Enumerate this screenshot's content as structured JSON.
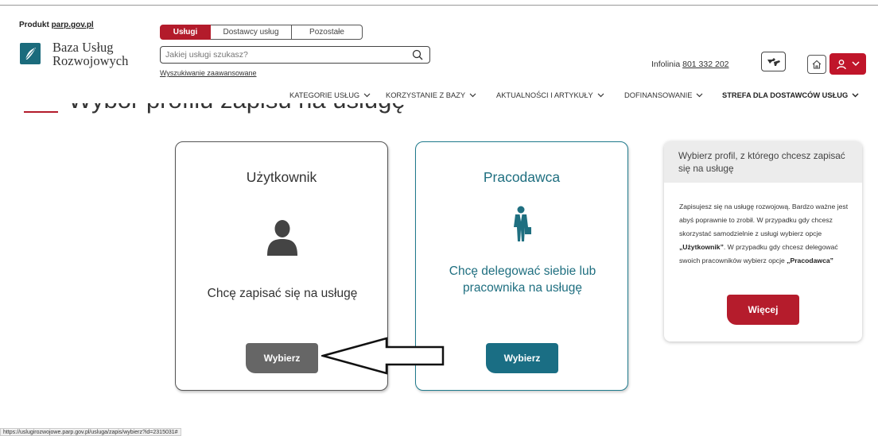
{
  "header": {
    "produkt_prefix": "Produkt ",
    "produkt_link": "parp.gov.pl",
    "logo_line1": "Baza Usług",
    "logo_line2": "Rozwojowych",
    "tabs": [
      {
        "label": "Usługi",
        "active": true
      },
      {
        "label": "Dostawcy usług",
        "active": false
      },
      {
        "label": "Pozostałe",
        "active": false
      }
    ],
    "search_placeholder": "Jakiej usługi szukasz?",
    "advanced_search": "Wyszukiwanie zaawansowane",
    "infolinia_label": "Infolinia ",
    "infolinia_number": "801 332 202",
    "accent_color": "#c0152a"
  },
  "nav": [
    {
      "label": "KATEGORIE USŁUG"
    },
    {
      "label": "KORZYSTANIE Z BAZY"
    },
    {
      "label": "AKTUALNOŚCI I ARTYKUŁY"
    },
    {
      "label": "DOFINANSOWANIE"
    },
    {
      "label": "STREFA DLA DOSTAWCÓW USŁUG"
    }
  ],
  "page": {
    "title": "Wybór profilu zapisu na usługę"
  },
  "cards": {
    "user": {
      "title": "Użytkownik",
      "description": "Chcę zapisać się na usługę",
      "button": "Wybierz"
    },
    "employer": {
      "title": "Pracodawca",
      "description": "Chcę delegować siebie lub pracownika na usługę",
      "button": "Wybierz"
    }
  },
  "info": {
    "heading": "Wybierz profil, z którego chcesz zapisać się na usługę",
    "body_1": "Zapisujesz się na usługę rozwojową. Bardzo ważne jest abyś poprawnie to zrobił. W przypadku gdy chcesz skorzystać samodzielnie z usługi wybierz opcje ",
    "body_user": "„Użytkownik”",
    "body_2": ". W przypadku gdy chcesz delegować swoich pracowników wybierz opcje ",
    "body_employer": "„Pracodawca”",
    "button": "Więcej"
  },
  "status_url": "https://uslugirozwojowe.parp.gov.pl/usluga/zapis/wybierz?id=2315031#"
}
